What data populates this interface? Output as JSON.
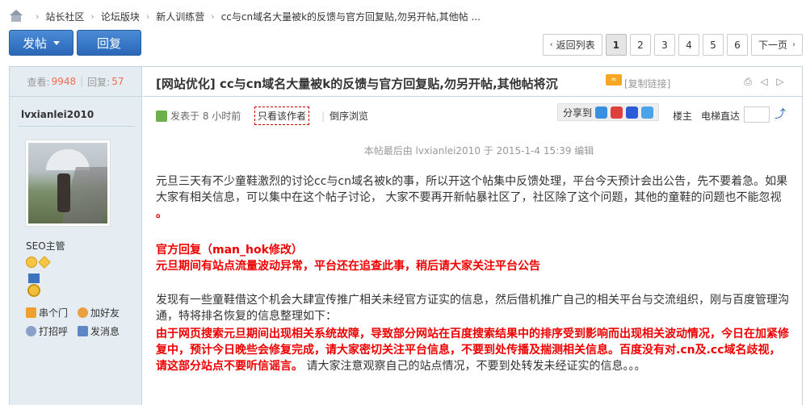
{
  "breadcrumb": {
    "items": [
      "站长社区",
      "论坛版块",
      "新人训练营"
    ],
    "current": "cc与cn域名大量被k的反馈与官方回复贴,勿另开帖,其他帖 ..."
  },
  "actions": {
    "post_label": "发帖",
    "reply_label": "回复"
  },
  "pager": {
    "back_label": "返回列表",
    "pages": [
      "1",
      "2",
      "3",
      "4",
      "5",
      "6"
    ],
    "current_page": "1",
    "next_label": "下一页"
  },
  "stats": {
    "views_label": "查看:",
    "views": "9948",
    "replies_label": "回复:",
    "replies": "57"
  },
  "author": {
    "name": "lvxianlei2010",
    "group": "SEO主管",
    "links": [
      "串个门",
      "加好友",
      "打招呼",
      "发消息"
    ]
  },
  "thread": {
    "category": "[网站优化]",
    "title": "cc与cn域名大量被k的反馈与官方回复贴,勿另开帖,其他帖将沉",
    "copy_link": "[复制链接]",
    "published": "发表于 8 小时前",
    "only_author": "只看该作者",
    "reverse": "倒序浏览",
    "share_label": "分享到",
    "floor_label": "楼主",
    "elevator_label": "电梯直达",
    "edited": "本帖最后由 lvxianlei2010 于 2015-1-4 15:39 编辑"
  },
  "content": {
    "p1": "元旦三天有不少童鞋激烈的讨论cc与cn域名被k的事，所以开这个帖集中反馈处理，平台今天预计会出公告，先不要着急。如果大家有相关信息，可以集中在这个帖子讨论， 大家不要再开新帖暴社区了，社区除了这个问题，其他的童鞋的问题也不能忽视",
    "p1_dot": " 。",
    "p2_line1": "官方回复（man_hok修改）",
    "p2_line2": "元旦期间有站点流量波动异常，平台还在追查此事，稍后请大家关注平台公告",
    "p3": "发现有一些童鞋借这个机会大肆宣传推广相关未经官方证实的信息，然后借机推广自己的相关平台与交流组织，刚与百度管理沟通，特将排名恢复的信息整理如下：",
    "p4_red": "由于网页搜索元旦期间出现相关系统故障，导致部分网站在百度搜索结果中的排序受到影响而出现相关波动情况，今日在加紧修复中，预计今日晚些会修复完成，请大家密切关注平台信息，不要到处传播及揣测相关信息。百度没有对.cn及.cc域名歧视，请这部分站点不要听信谣言。",
    "p4_tail": " 请大家注意观察自己的站点情况，不要到处转发未经证实的信息。。。"
  },
  "colors": {
    "accent": "#2a68b8",
    "red": "#e00000",
    "count": "#f26c4f"
  }
}
